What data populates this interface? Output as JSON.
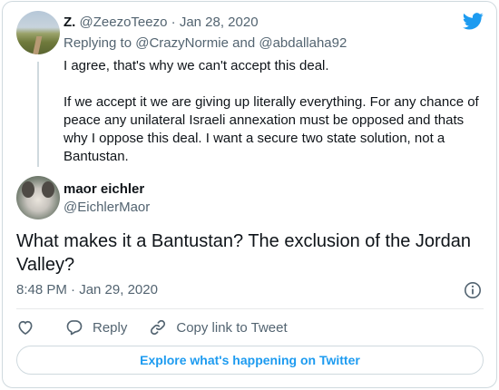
{
  "parent_tweet": {
    "name": "Z.",
    "handle": "@ZeezoTeezo",
    "separator": "·",
    "date": "Jan 28, 2020",
    "replying_to_label": "Replying to",
    "replying_to_user1": "@CrazyNormie",
    "replying_and": "and",
    "replying_to_user2": "@abdallaha92",
    "text": "I agree, that's why we can't accept this deal.\n\nIf we accept it we are giving up literally everything. For any chance of peace any unilateral Israeli annexation must be opposed and thats why I oppose this deal. I want a secure two state solution, not a Bantustan."
  },
  "main_tweet": {
    "name": "maor eichler",
    "handle": "@EichlerMaor",
    "text": "What makes it a Bantustan? The exclusion of the Jordan Valley?",
    "timestamp": "8:48 PM · Jan 29, 2020"
  },
  "actions": {
    "reply_label": "Reply",
    "copy_link_label": "Copy link to Tweet"
  },
  "explore_label": "Explore what's happening on Twitter",
  "icons": {
    "brand": "twitter-bird-icon",
    "like": "heart-icon",
    "reply": "reply-bubble-icon",
    "copy": "link-icon",
    "info": "info-icon"
  },
  "colors": {
    "brand_blue": "#1d9bf0",
    "secondary_text": "#536471",
    "border": "#cfd9de"
  }
}
